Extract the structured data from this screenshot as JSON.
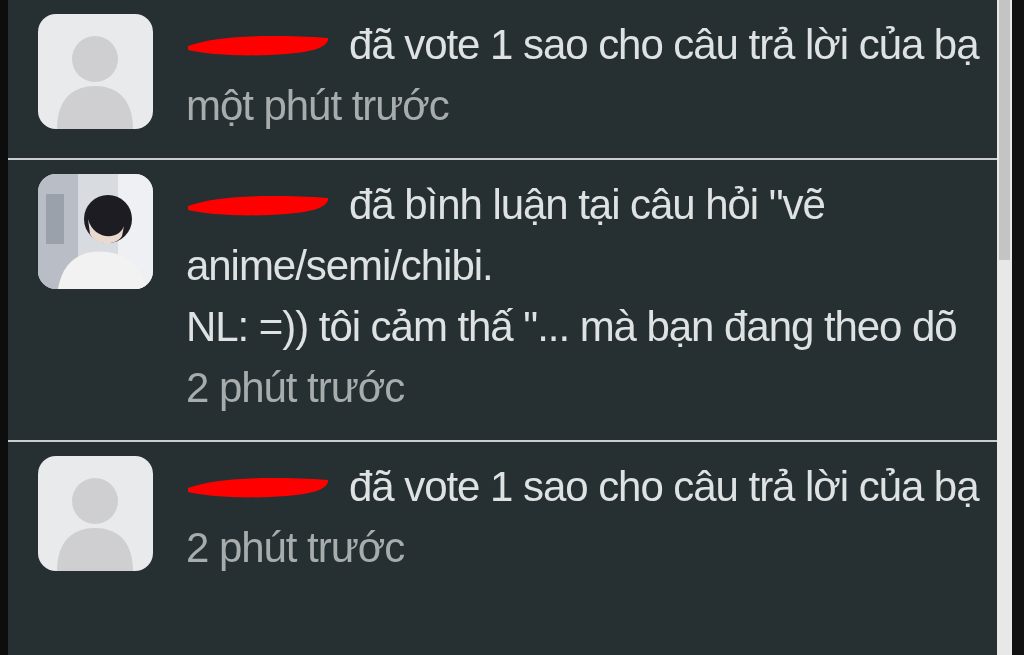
{
  "notifications": [
    {
      "avatar": {
        "kind": "placeholder"
      },
      "lines": [
        "đã vote 1 sao cho câu trả lời của bạ"
      ],
      "time": "một phút trước"
    },
    {
      "lines": [
        "đã bình luận tại câu hỏi \"vẽ",
        "anime/semi/chibi.",
        "NL: =)) tôi cảm thấ \"... mà bạn đang theo dõ"
      ],
      "time": "2 phút trước"
    },
    {
      "avatar": {
        "kind": "placeholder"
      },
      "lines": [
        "đã vote 1 sao cho câu trả lời của bạ"
      ],
      "time": "2 phút trước"
    }
  ]
}
